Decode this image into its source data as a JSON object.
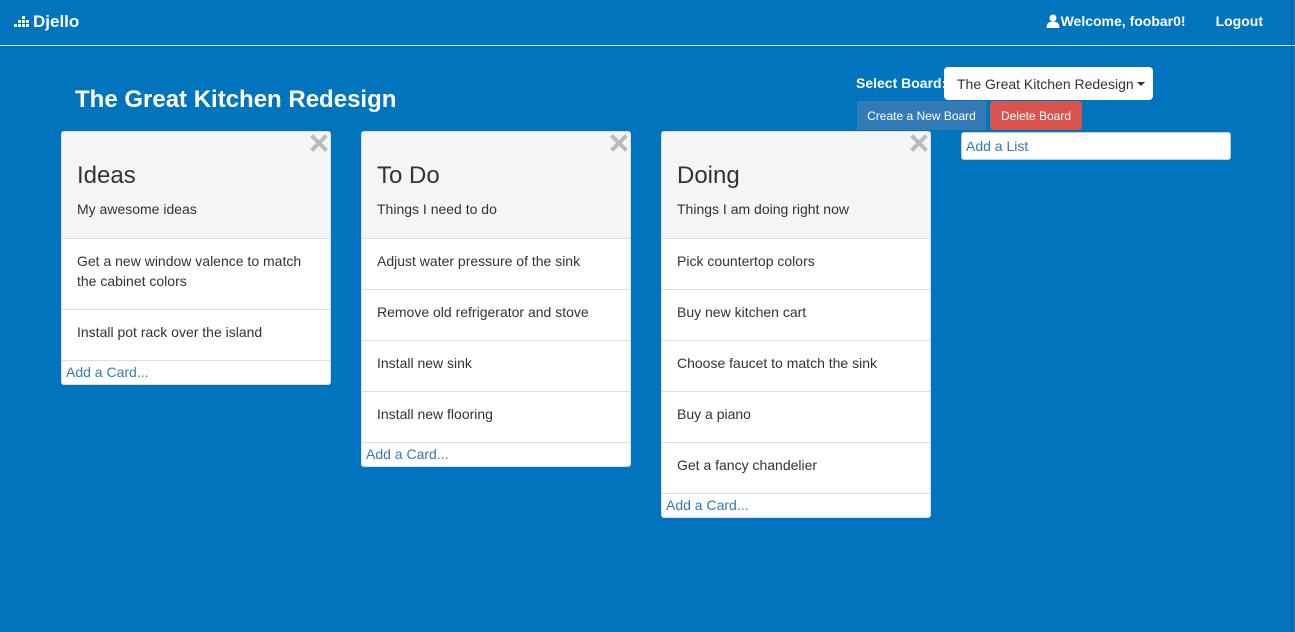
{
  "navbar": {
    "brand": "Djello",
    "welcome": "Welcome, foobar0!",
    "logout": "Logout"
  },
  "board": {
    "title": "The Great Kitchen Redesign",
    "select_label": "Select Board:",
    "selected": "The Great Kitchen Redesign",
    "create_label": "Create a New Board",
    "delete_label": "Delete Board",
    "add_list_label": "Add a List"
  },
  "lists": [
    {
      "title": "Ideas",
      "description": "My awesome ideas",
      "cards": [
        "Get a new window valence to match the cabinet colors",
        "Install pot rack over the island"
      ],
      "add_card": "Add a Card..."
    },
    {
      "title": "To Do",
      "description": "Things I need to do",
      "cards": [
        "Adjust water pressure of the sink",
        "Remove old refrigerator and stove",
        "Install new sink",
        "Install new flooring"
      ],
      "add_card": "Add a Card..."
    },
    {
      "title": "Doing",
      "description": "Things I am doing right now",
      "cards": [
        "Pick countertop colors",
        "Buy new kitchen cart",
        "Choose faucet to match the sink",
        "Buy a piano",
        "Get a fancy chandelier"
      ],
      "add_card": "Add a Card..."
    }
  ],
  "colors": {
    "background": "#0075be",
    "primary_button": "#337ab7",
    "danger_button": "#d9534f",
    "link": "#337ab7"
  }
}
